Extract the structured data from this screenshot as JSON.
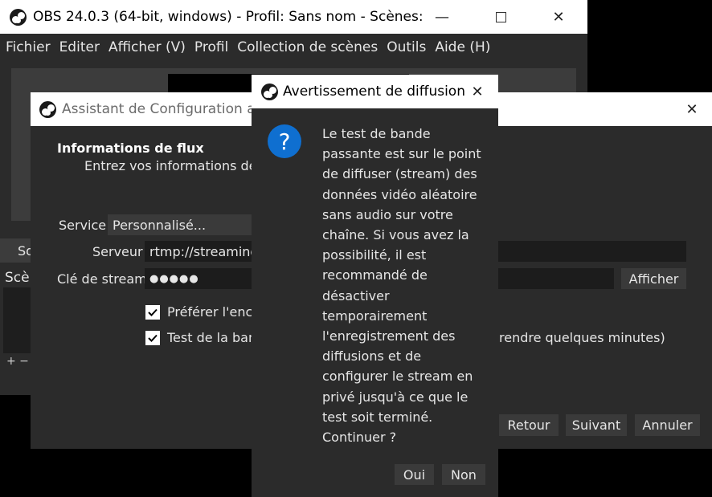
{
  "main_window": {
    "title": "OBS 24.0.3 (64-bit, windows) - Profil: Sans nom - Scènes: ...",
    "menu": [
      "Fichier",
      "Editer",
      "Afficher (V)",
      "Profil",
      "Collection de scènes",
      "Outils",
      "Aide (H)"
    ],
    "controls_tab": "So",
    "scenes_header": "Scèn",
    "scene_buttons": "+ −"
  },
  "wizard": {
    "title": "Assistant de Configuration au",
    "section_title": "Informations de flux",
    "section_subtitle": "Entrez vos informations de s",
    "service_label": "Service",
    "service_value": "Personnalisé...",
    "server_label": "Serveur",
    "server_value": "rtmp://streaming",
    "key_label": "Clé de stream",
    "key_value": "●●●●●",
    "show_button": "Afficher",
    "check1_label": "Préférer l'enco",
    "check2_label": "Test de la band",
    "check2_suffix": "rendre quelques minutes)",
    "back_button": "Retour",
    "next_button": "Suivant",
    "cancel_button": "Annuler"
  },
  "dialog": {
    "title": "Avertissement de diffusion",
    "lines": [
      "Le test de bande",
      "passante est sur le point",
      "de diffuser (stream) des",
      "données vidéo aléatoire",
      "sans audio sur votre",
      "chaîne. Si vous avez la",
      "possibilité, il est",
      "recommandé de",
      "désactiver",
      "temporairement",
      "l'enregistrement des",
      "diffusions et de",
      "configurer le stream en",
      "privé jusqu'à ce que le",
      "test soit terminé.",
      "Continuer ?"
    ],
    "yes_button": "Oui",
    "no_button": "Non"
  },
  "colors": {
    "accent_blue": "#0f6fd0",
    "dark_bg": "#2b2b2b"
  }
}
